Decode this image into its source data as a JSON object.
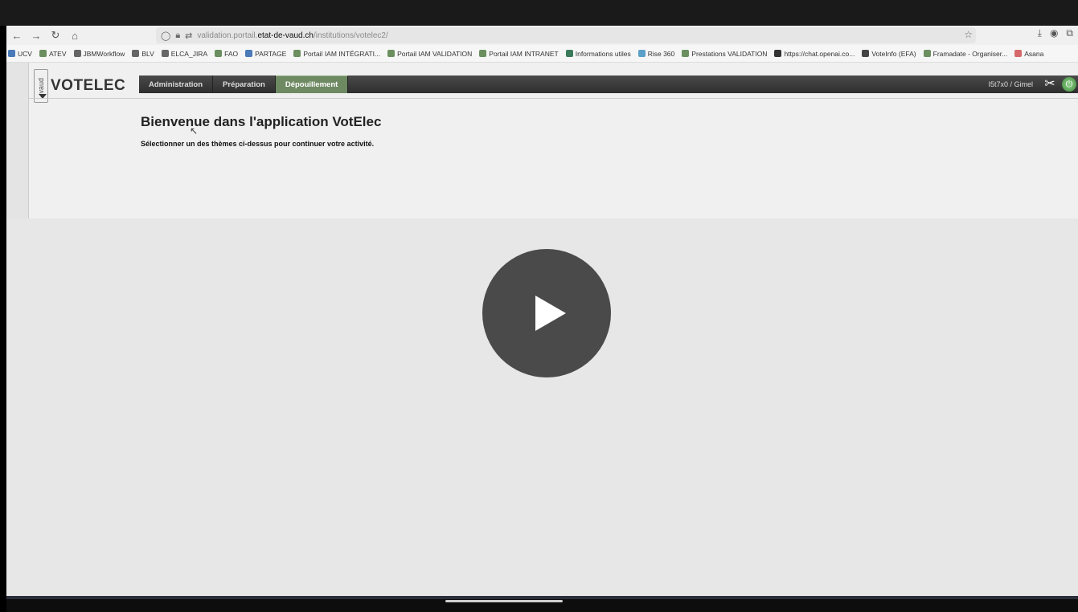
{
  "browser": {
    "url_prefix": "validation.portail.",
    "url_domain": "etat-de-vaud.ch",
    "url_path": "/institutions/votelec2/",
    "bookmarks": [
      {
        "label": "UCV",
        "color": "#4a7ab8"
      },
      {
        "label": "ATEV",
        "color": "#6b8f5e"
      },
      {
        "label": "JBMWorkflow",
        "color": "#666666"
      },
      {
        "label": "BLV",
        "color": "#666666"
      },
      {
        "label": "ELCA_JIRA",
        "color": "#666666"
      },
      {
        "label": "FAO",
        "color": "#6b8f5e"
      },
      {
        "label": "PARTAGE",
        "color": "#4a7ab8"
      },
      {
        "label": "Portail IAM INTÉGRATI...",
        "color": "#6b8f5e"
      },
      {
        "label": "Portail IAM VALIDATION",
        "color": "#6b8f5e"
      },
      {
        "label": "Portail IAM INTRANET",
        "color": "#6b8f5e"
      },
      {
        "label": "Informations utiles",
        "color": "#3b7a5a"
      },
      {
        "label": "Rise 360",
        "color": "#5aa0c8"
      },
      {
        "label": "Prestations VALIDATION",
        "color": "#6b8f5e"
      },
      {
        "label": "https://chat.openai.co...",
        "color": "#333333"
      },
      {
        "label": "VoteInfo (EFA)",
        "color": "#444444"
      },
      {
        "label": "Framadate - Organiser...",
        "color": "#6b8f5e"
      },
      {
        "label": "Asana",
        "color": "#d66a6a"
      }
    ]
  },
  "app": {
    "logo_text": "vaud",
    "title": "VOTELEC",
    "menu": [
      {
        "label": "Administration",
        "active": false
      },
      {
        "label": "Préparation",
        "active": false
      },
      {
        "label": "Dépouillement",
        "active": true
      }
    ],
    "user": "I5t7x0 / Gimel",
    "welcome_title": "Bienvenue dans l'application VotElec",
    "welcome_subtitle": "Sélectionner un des thèmes ci-dessus pour continuer votre activité."
  },
  "player": {
    "play_icon": "play-icon"
  }
}
